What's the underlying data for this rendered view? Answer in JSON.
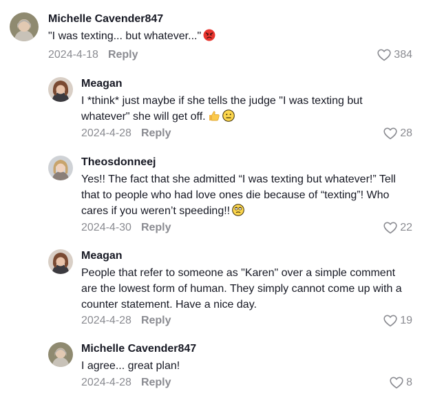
{
  "comments": [
    {
      "username": "Michelle Cavender847",
      "text": "\"I was texting... but whatever...\"",
      "emoji": "angry-face-emoji",
      "date": "2024-4-18",
      "reply_label": "Reply",
      "likes": "384"
    },
    {
      "username": "Meagan",
      "text": "I *think* just maybe if she tells the judge \"I was texting but whatever\" she will get off.",
      "emoji": "thumbs-up-and-neutral-face-emoji",
      "date": "2024-4-28",
      "reply_label": "Reply",
      "likes": "28"
    },
    {
      "username": "Theosdonneej",
      "text": "Yes!! The fact that she admitted “I was texting but whatever!” Tell that to people who had love ones die because of “texting”! Who cares if you weren’t speeding!!",
      "emoji": "eye-roll-face-emoji",
      "date": "2024-4-30",
      "reply_label": "Reply",
      "likes": "22"
    },
    {
      "username": "Meagan",
      "text": "People that refer to someone as \"Karen\" over a simple comment are the lowest form of human. They simply cannot come up with a counter statement. Have a nice day.",
      "emoji": "",
      "date": "2024-4-28",
      "reply_label": "Reply",
      "likes": "19"
    },
    {
      "username": "Michelle Cavender847",
      "text": "I agree... great plan!",
      "emoji": "",
      "date": "2024-4-28",
      "reply_label": "Reply",
      "likes": "8"
    }
  ]
}
